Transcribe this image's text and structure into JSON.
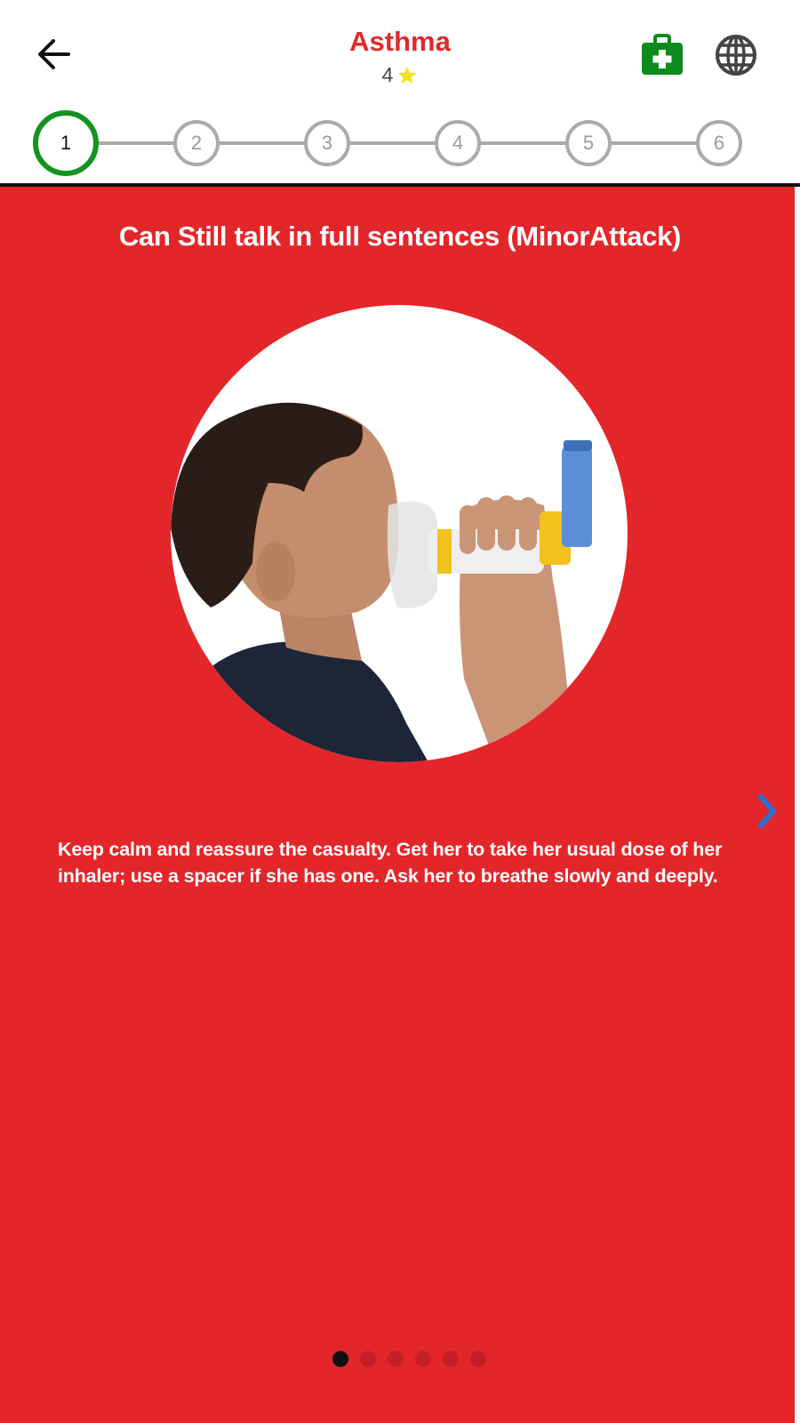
{
  "header": {
    "title": "Asthma",
    "rating_value": "4",
    "back_icon": "arrow-left-icon",
    "kit_icon": "first-aid-kit-icon",
    "globe_icon": "globe-icon",
    "star_icon": "star-icon"
  },
  "stepper": {
    "steps": [
      "1",
      "2",
      "3",
      "4",
      "5",
      "6"
    ],
    "active_step": 1
  },
  "slide": {
    "title": "Can Still talk in full sentences (MinorAttack)",
    "image_alt": "child-using-inhaler-with-spacer",
    "instructions": "Keep calm and reassure the casualty. Get her to take her usual dose of her inhaler; use a spacer if she has one. Ask her to breathe slowly and deeply.",
    "next_icon": "chevron-right-icon"
  },
  "pagination": {
    "total": 6,
    "current": 1
  },
  "colors": {
    "brand_red": "#e3262a",
    "title_red": "#e02a2b",
    "step_active_green": "#14931f",
    "kit_green": "#0d8a1e",
    "star_yellow": "#f2e21a",
    "next_arrow_blue": "#2d6fd6"
  }
}
